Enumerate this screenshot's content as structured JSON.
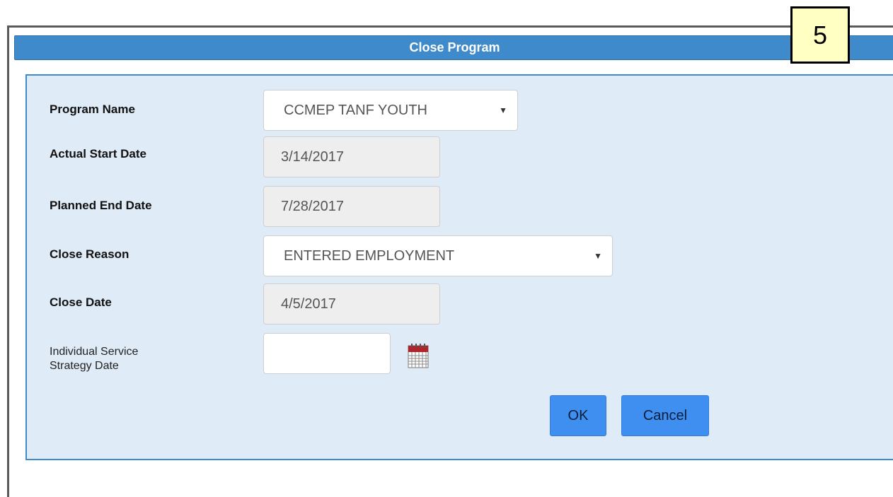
{
  "dialog": {
    "title": "Close Program",
    "callout_number": "5"
  },
  "form": {
    "program_name": {
      "label": "Program Name",
      "value": "CCMEP TANF YOUTH"
    },
    "actual_start_date": {
      "label": "Actual Start Date",
      "value": "3/14/2017"
    },
    "planned_end_date": {
      "label": "Planned End Date",
      "value": "7/28/2017"
    },
    "close_reason": {
      "label": "Close Reason",
      "value": "ENTERED EMPLOYMENT"
    },
    "close_date": {
      "label": "Close Date",
      "value": "4/5/2017"
    },
    "iss_date": {
      "label_line1": "Individual Service",
      "label_line2": "Strategy Date",
      "value": ""
    }
  },
  "buttons": {
    "ok_label": "OK",
    "cancel_label": "Cancel"
  },
  "icons": {
    "select_arrow": "chevron-down-icon",
    "calendar": "calendar-icon"
  },
  "colors": {
    "titlebar": "#3f8acb",
    "panel_bg": "#dfebf7",
    "button": "#3e8ff0",
    "callout_bg": "#ffffc4"
  }
}
